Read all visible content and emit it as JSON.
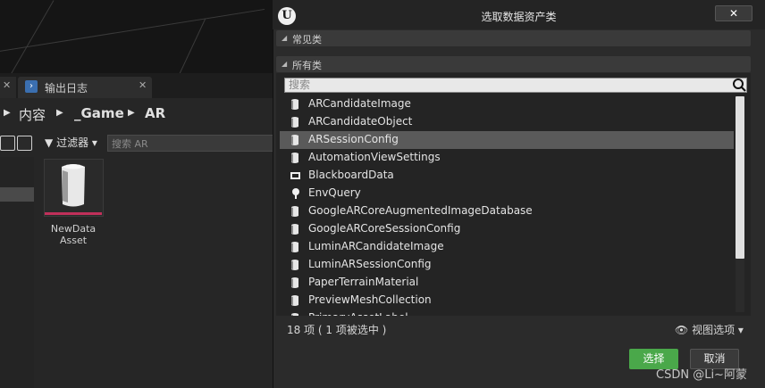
{
  "bg_editor": {
    "tab_label": "输出日志",
    "breadcrumb": [
      "内容",
      "_Game",
      "AR"
    ],
    "filter_label": "过滤器",
    "search_placeholder": "搜索 AR",
    "asset_name_line1": "NewData",
    "asset_name_line2": "Asset"
  },
  "dialog": {
    "title": "选取数据资产类",
    "close_label": "✕",
    "common_section": "常见类",
    "all_section": "所有类",
    "search_placeholder": "搜索",
    "items": [
      {
        "label": "ARCandidateImage",
        "icon": "asset-icon",
        "selected": false
      },
      {
        "label": "ARCandidateObject",
        "icon": "asset-icon",
        "selected": false
      },
      {
        "label": "ARSessionConfig",
        "icon": "asset-icon",
        "selected": true
      },
      {
        "label": "AutomationViewSettings",
        "icon": "asset-icon",
        "selected": false
      },
      {
        "label": "BlackboardData",
        "icon": "blackboard-icon",
        "selected": false
      },
      {
        "label": "EnvQuery",
        "icon": "query-icon",
        "selected": false
      },
      {
        "label": "GoogleARCoreAugmentedImageDatabase",
        "icon": "asset-icon",
        "selected": false
      },
      {
        "label": "GoogleARCoreSessionConfig",
        "icon": "asset-icon",
        "selected": false
      },
      {
        "label": "LuminARCandidateImage",
        "icon": "asset-icon",
        "selected": false
      },
      {
        "label": "LuminARSessionConfig",
        "icon": "asset-icon",
        "selected": false
      },
      {
        "label": "PaperTerrainMaterial",
        "icon": "asset-icon",
        "selected": false
      },
      {
        "label": "PreviewMeshCollection",
        "icon": "asset-icon",
        "selected": false
      },
      {
        "label": "PrimaryAssetLabel",
        "icon": "asset-icon",
        "selected": false
      }
    ],
    "count_text": "18 项 ( 1 项被选中 )",
    "view_options": "视图选项",
    "select_button": "选择",
    "cancel_button": "取消"
  },
  "watermark": "CSDN @Li~阿蒙",
  "colors": {
    "accent_green": "#4aa84a",
    "asset_strip": "#c0305a",
    "selection": "#5a5a5a"
  }
}
